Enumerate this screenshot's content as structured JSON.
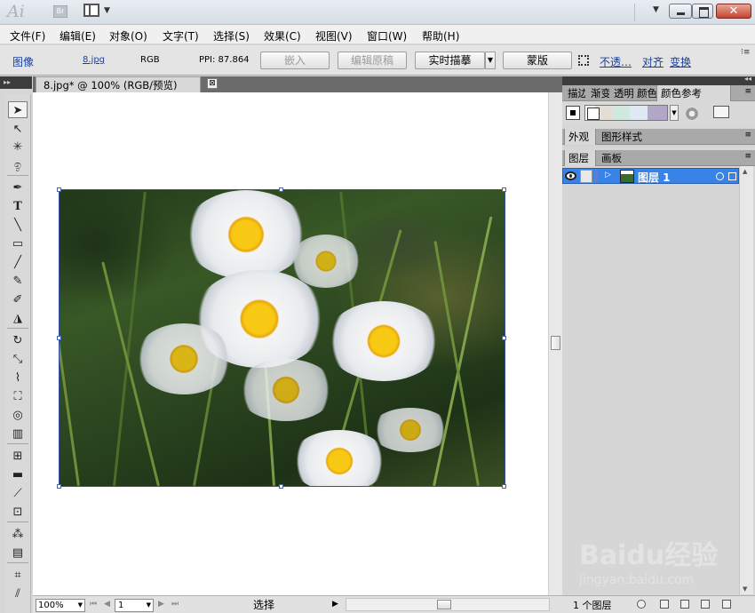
{
  "app": {
    "logo": "Ai",
    "bridge_label": "Br"
  },
  "menu": [
    "文件(F)",
    "编辑(E)",
    "对象(O)",
    "文字(T)",
    "选择(S)",
    "效果(C)",
    "视图(V)",
    "窗口(W)",
    "帮助(H)"
  ],
  "control_bar": {
    "type_label": "图像",
    "file_link": "8.jpg",
    "color_mode": "RGB",
    "ppi": "PPI: 87.864",
    "embed_button": "嵌入",
    "edit_original_button": "编辑原稿",
    "live_trace_button": "实时描摹",
    "mask_button": "蒙版",
    "opacity_link": "不透…",
    "align_link": "对齐",
    "transform_link": "变换"
  },
  "document": {
    "tab_title": "8.jpg* @ 100% (RGB/预览)",
    "tab_close": "⊠"
  },
  "status_bar": {
    "zoom": "100%",
    "page": "1",
    "status_text": "选择"
  },
  "panels": {
    "group1_tabs": [
      "描边",
      "渐变",
      "透明",
      "颜色",
      "颜色参考"
    ],
    "group2_tabs": [
      "外观",
      "图形样式"
    ],
    "group3_tabs": [
      "图层",
      "画板"
    ],
    "layer_name": "图层 1",
    "layer_count": "1 个图层"
  },
  "watermark": {
    "text": "Baidu经验",
    "url": "jingyan.baidu.com"
  },
  "colors": {
    "selection_blue": "#3983e8",
    "link_blue": "#1a3f9c",
    "close_red": "#c4432e"
  }
}
